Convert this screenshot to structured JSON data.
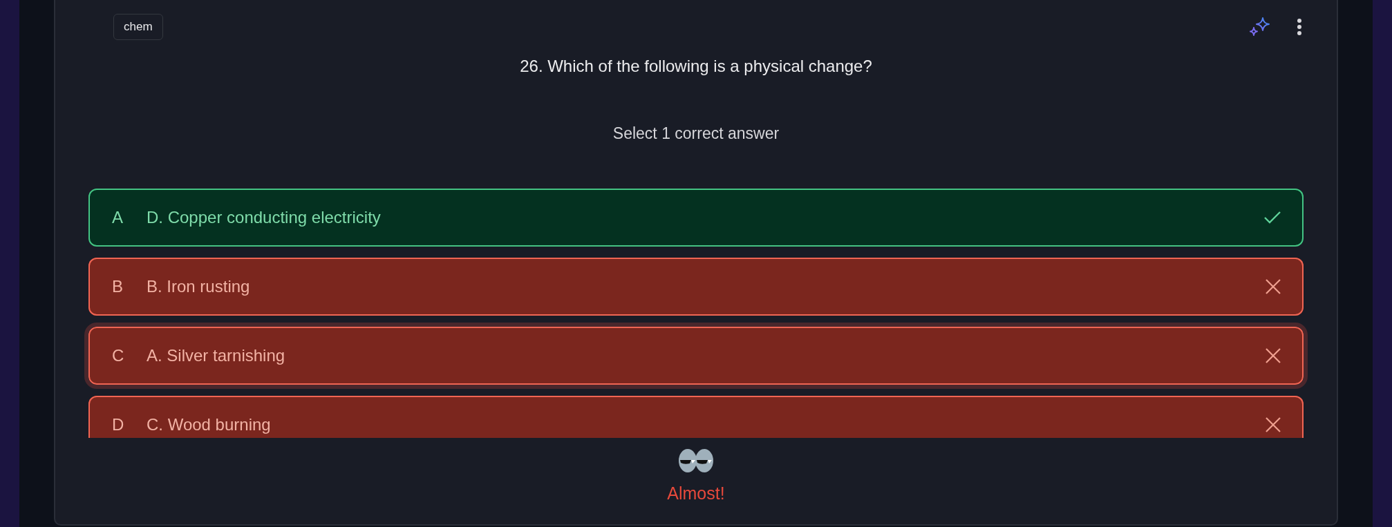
{
  "tag": "chem",
  "question": "26. Which of the following is a physical change?",
  "instruction": "Select 1 correct answer",
  "options": [
    {
      "letter": "A",
      "text": "D. Copper conducting electricity",
      "kind": "correct",
      "selected": false
    },
    {
      "letter": "B",
      "text": "B. Iron rusting",
      "kind": "wrong",
      "selected": false
    },
    {
      "letter": "C",
      "text": "A. Silver tarnishing",
      "kind": "wrong",
      "selected": true
    },
    {
      "letter": "D",
      "text": "C. Wood burning",
      "kind": "wrong",
      "selected": false
    }
  ],
  "feedback": "Almost!"
}
